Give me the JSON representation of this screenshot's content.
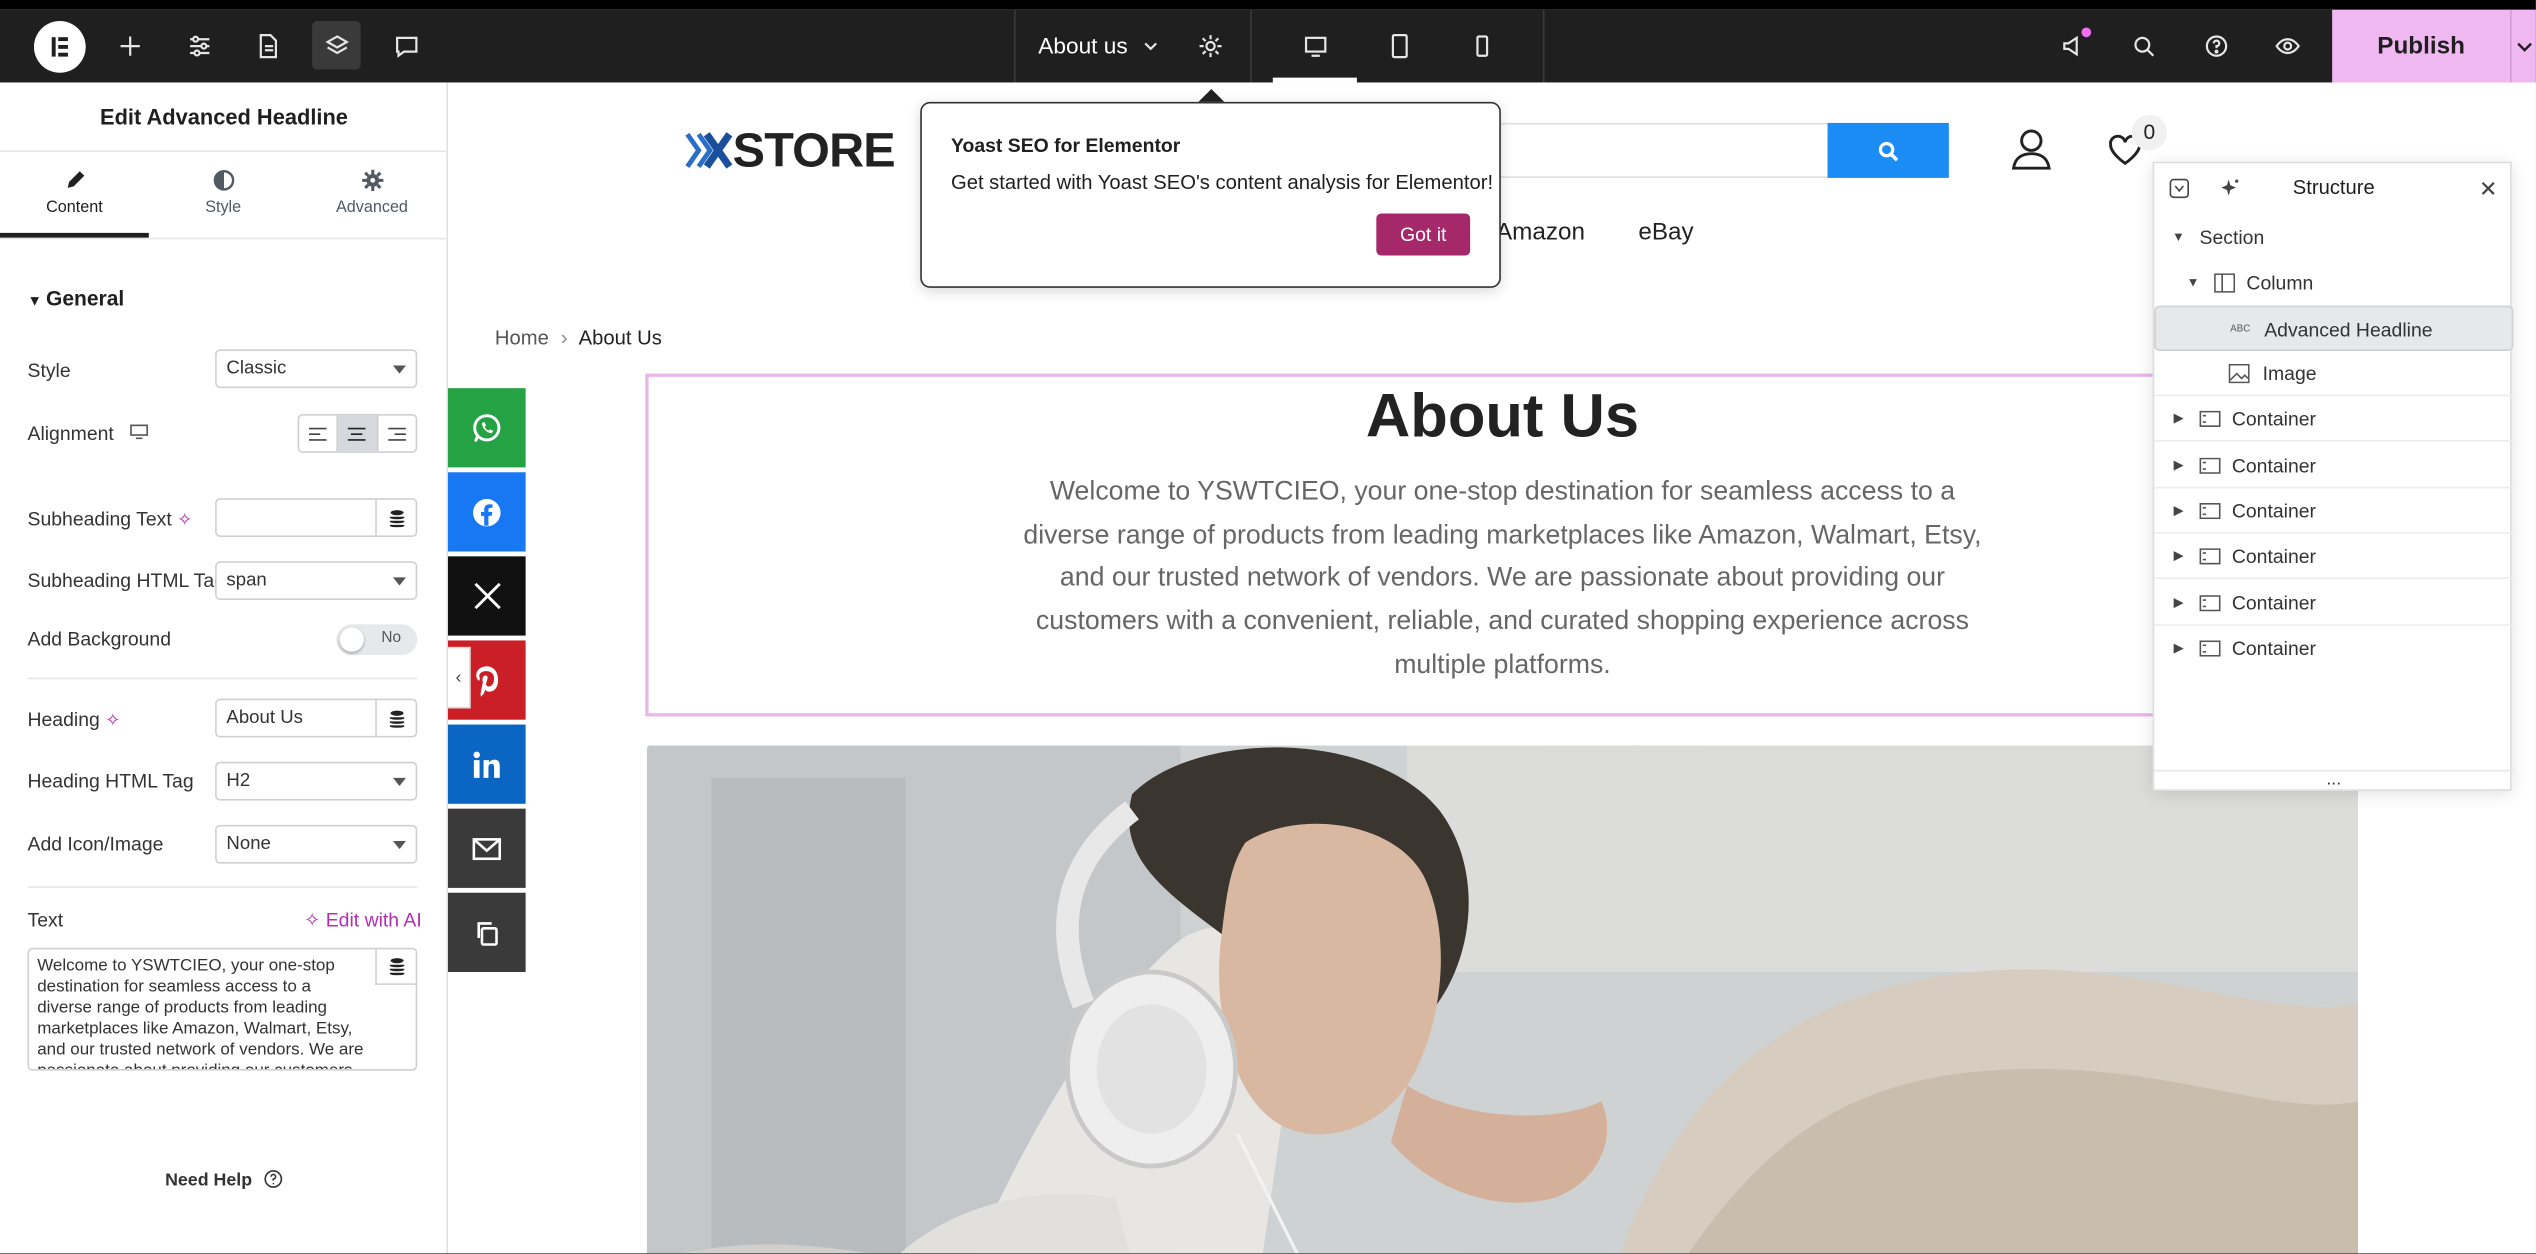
{
  "topbar": {
    "page_title": "About us",
    "publish_label": "Publish"
  },
  "panel": {
    "title": "Edit Advanced Headline",
    "tabs": [
      {
        "label": "Content"
      },
      {
        "label": "Style"
      },
      {
        "label": "Advanced"
      }
    ],
    "section_general": "General",
    "style_label": "Style",
    "style_value": "Classic",
    "alignment_label": "Alignment",
    "subheading_text_label": "Subheading Text",
    "subheading_text_value": "",
    "subheading_tag_label": "Subheading HTML Tag",
    "subheading_tag_value": "span",
    "add_background_label": "Add Background",
    "add_background_value": "No",
    "heading_label": "Heading",
    "heading_value": "About Us",
    "heading_tag_label": "Heading HTML Tag",
    "heading_tag_value": "H2",
    "add_icon_label": "Add Icon/Image",
    "add_icon_value": "None",
    "text_label": "Text",
    "edit_ai_label": "Edit with AI",
    "text_value": "Welcome to YSWTCIEO, your one-stop destination for seamless access to a diverse range of products from leading marketplaces like Amazon, Walmart, Etsy, and our trusted network of vendors. We are passionate about providing our customers with a convenient",
    "need_help": "Need Help"
  },
  "site": {
    "logo_text": "STORE",
    "logo_mark": "X",
    "wishlist_count": "0",
    "nav": [
      "Amazon",
      "eBay"
    ],
    "breadcrumb_home": "Home",
    "breadcrumb_current": "About Us",
    "headline": "About Us",
    "intro": "Welcome to YSWTCIEO, your one-stop destination for seamless access to a diverse range of products from leading marketplaces like Amazon, Walmart, Etsy, and our trusted network of vendors. We are passionate about providing our customers with a convenient, reliable, and curated shopping experience across multiple platforms."
  },
  "share": [
    {
      "icon": "whatsapp-icon",
      "color": "#25a244"
    },
    {
      "icon": "facebook-icon",
      "color": "#1877f2"
    },
    {
      "icon": "x-icon",
      "color": "#111111"
    },
    {
      "icon": "pinterest-icon",
      "color": "#cb1f27"
    },
    {
      "icon": "linkedin-icon",
      "color": "#0a66c2"
    },
    {
      "icon": "email-icon",
      "color": "#3a3a3a"
    },
    {
      "icon": "copy-icon",
      "color": "#3a3a3a"
    }
  ],
  "yoast": {
    "title": "Yoast SEO for Elementor",
    "body": "Get started with Yoast SEO's content analysis for Elementor!",
    "button": "Got it"
  },
  "structure": {
    "title": "Structure",
    "items": [
      {
        "label": "Section"
      },
      {
        "label": "Column"
      },
      {
        "label": "Advanced Headline"
      },
      {
        "label": "Image"
      },
      {
        "label": "Container"
      },
      {
        "label": "Container"
      },
      {
        "label": "Container"
      },
      {
        "label": "Container"
      },
      {
        "label": "Container"
      },
      {
        "label": "Container"
      }
    ],
    "footer": "..."
  },
  "colors": {
    "publish_bg": "#f0b8f0",
    "got_it_bg": "#a4286a",
    "search_button": "#1c8cf5",
    "selection_border": "#e8b6e8"
  }
}
